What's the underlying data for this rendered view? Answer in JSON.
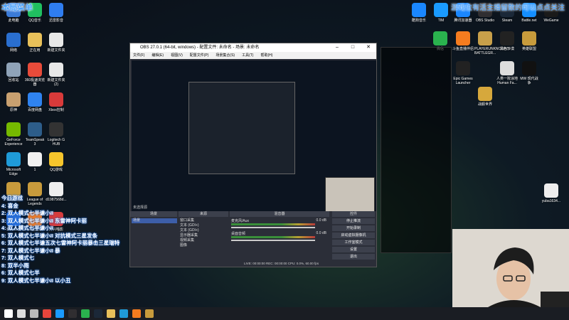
{
  "overlay": {
    "title": "本局菜单",
    "notice": "游戏位有活主播留数的可以点点关注",
    "lines": [
      "今日游戏",
      "4: 喜金",
      "2: 双人模式七半谦小II",
      "3: 双人模式七半谦小II 东雷神阿卡丽",
      "4: 双人模式七半谦小II",
      "5: 双人模式七半谦小II 对抗模式三星发条",
      "6: 双人模式七半谦五次七雷神阿卡丽暴击三星瑞特",
      "7: 双人模式七半谦小II 暴",
      "7: 双人模式七",
      "8: 双半小雨",
      "6: 双人模式七半",
      "9: 双人模式七半谦小II 以小丑"
    ]
  },
  "desktop_icons_left": [
    {
      "label": "此电脑",
      "icon": "pc-icon",
      "color": "#3b7bd8"
    },
    {
      "label": "QQ音乐",
      "icon": "qqmusic-icon",
      "color": "#20c060"
    },
    {
      "label": "迅雷影音",
      "icon": "xunlei-icon",
      "color": "#2f7df0"
    },
    {
      "label": "网络",
      "icon": "network-icon",
      "color": "#2a6fd0"
    },
    {
      "label": "正在用",
      "icon": "folder-icon",
      "color": "#e8c05a"
    },
    {
      "label": "新建文件夹",
      "icon": "file-icon",
      "color": "#e8e8e8"
    },
    {
      "label": "回收站",
      "icon": "recycle-icon",
      "color": "#8fa3b8"
    },
    {
      "label": "360极速浏览器",
      "icon": "360-icon",
      "color": "#e84b3a"
    },
    {
      "label": "新建文件夹 (2)",
      "icon": "file-icon",
      "color": "#e8e8e8"
    },
    {
      "label": "原神",
      "icon": "genshin-icon",
      "color": "#c8a070"
    },
    {
      "label": "百度网盘",
      "icon": "baidu-icon",
      "color": "#2f83f0"
    },
    {
      "label": "Xbox控制",
      "icon": "xbox-icon",
      "color": "#d83a3a"
    },
    {
      "label": "GeForce Experience",
      "icon": "nvidia-icon",
      "color": "#76b900"
    },
    {
      "label": "TeamSpeak 3",
      "icon": "teamspeak-icon",
      "color": "#2d5d8a"
    },
    {
      "label": "Logitech G HUB",
      "icon": "logitech-icon",
      "color": "#333"
    },
    {
      "label": "Microsoft Edge",
      "icon": "edge-icon",
      "color": "#1f9bd8"
    },
    {
      "label": "1",
      "icon": "file-icon",
      "color": "#f0f0f0"
    },
    {
      "label": "QQ游戏",
      "icon": "qqgame-icon",
      "color": "#f6c52c"
    },
    {
      "label": "英雄联盟",
      "icon": "lol-icon",
      "color": "#c89b3c"
    },
    {
      "label": "League of Legends",
      "icon": "lol-icon",
      "color": "#c89b3c"
    },
    {
      "label": "d1987568d...",
      "icon": "file-icon",
      "color": "#eee"
    },
    {
      "label": "Bandizip",
      "icon": "bandizip-icon",
      "color": "#2b6fd6"
    },
    {
      "label": "斗鱼直播",
      "icon": "douyu-icon",
      "color": "#f57c1f"
    },
    {
      "label": "万兴喵影",
      "icon": "wondershare-icon",
      "color": "#d63c3c"
    }
  ],
  "desktop_icons_right": [
    {
      "label": "酷狗音乐",
      "icon": "kugou-icon",
      "color": "#1a87ff"
    },
    {
      "label": "TIM",
      "icon": "tim-icon",
      "color": "#1a9bff"
    },
    {
      "label": "腾讯加速器",
      "icon": "tencent-accel-icon",
      "color": "#1a87ff"
    },
    {
      "label": "OBS Studio",
      "icon": "obs-icon",
      "color": "#302e31"
    },
    {
      "label": "Steam",
      "icon": "steam-icon",
      "color": "#1b2838"
    },
    {
      "label": "Battle.net",
      "icon": "battlenet-icon",
      "color": "#148eff"
    },
    {
      "label": "WeGame",
      "icon": "wegame-icon",
      "color": "#1a1a1a"
    },
    {
      "label": "微信",
      "icon": "wechat-icon",
      "color": "#2ab24e"
    },
    {
      "label": "斗鱼直播伴侣",
      "icon": "douyu-icon",
      "color": "#f57c1f"
    },
    {
      "label": "PLAYERUNKNOWN'S BATTLEGR...",
      "icon": "pubg-icon",
      "color": "#c8a04a"
    },
    {
      "label": "黑色沙漠",
      "icon": "blackdesert-icon",
      "color": "#222"
    },
    {
      "label": "英雄联盟",
      "icon": "lol-icon",
      "color": "#c89b3c"
    },
    {
      "label": "Epic Games Launcher",
      "icon": "epic-icon",
      "color": "#222"
    },
    {
      "label": "人类一败涂地 Human Fa...",
      "icon": "human-icon",
      "color": "#ddd"
    },
    {
      "label": "MW 现代战争",
      "icon": "mw-icon",
      "color": "#111"
    },
    {
      "label": "战舰世界",
      "icon": "wows-icon",
      "color": "#d6a83c"
    },
    {
      "label": "yuba1634...",
      "icon": "file-icon",
      "color": "#eee"
    }
  ],
  "obs": {
    "title": "OBS 27.0.1 (64-bit, windows) - 配置文件: 未命名 - 场景: 未命名",
    "menu": [
      "文件(F)",
      "编辑(E)",
      "视图(V)",
      "配置文件(P)",
      "场景集合(S)",
      "工具(T)",
      "帮助(H)"
    ],
    "source_missing": "未选择源",
    "docks": {
      "scenes": "场景",
      "sources": "来源",
      "mixer": "混音器",
      "transitions": "转场",
      "controls": "控件"
    },
    "scene_list": [
      "场景"
    ],
    "source_list": [
      "窗口采集",
      "文本 (GDI+)",
      "文本 (GDI+)",
      "显示器采集",
      "视频采集",
      "图像"
    ],
    "mixer_tracks": [
      {
        "name": "麦克风/Aux",
        "db": "0.0 dB"
      },
      {
        "name": "桌面音频",
        "db": "0.0 dB"
      }
    ],
    "controls": [
      "停止推流",
      "开始录制",
      "启动虚拟摄像机",
      "工作室模式",
      "设置",
      "退出"
    ],
    "status": "LIVE: 00:00:00   REC: 00:00:00   CPU: 0.0%, 60.00 fps"
  },
  "taskbar": {
    "icons": [
      "windows-icon",
      "search-icon",
      "task-view-icon",
      "chrome-icon",
      "qq-icon",
      "obs-icon",
      "wechat-icon",
      "steam-icon",
      "explorer-icon",
      "edge-icon",
      "douyu-icon",
      "lol-icon"
    ]
  }
}
